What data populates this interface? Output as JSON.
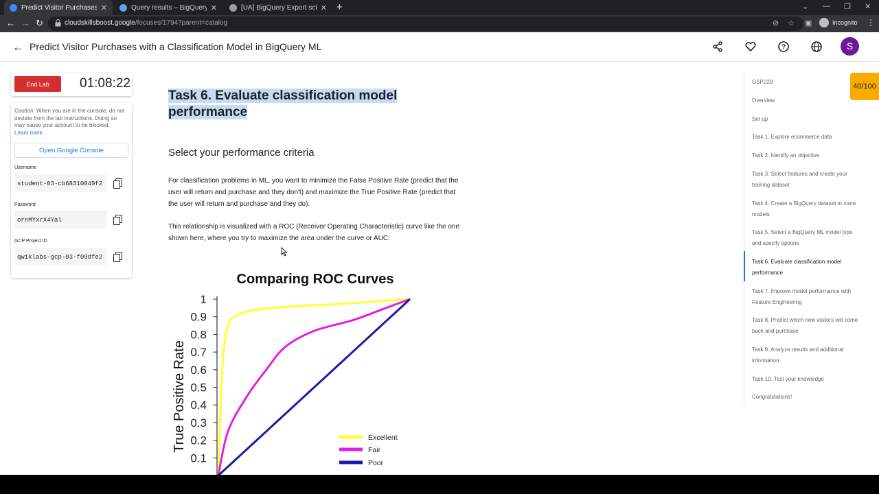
{
  "browser": {
    "tabs": [
      {
        "title": "Predict Visitor Purchases with a C",
        "active": true
      },
      {
        "title": "Query results – BigQuery – qwikl",
        "active": false
      },
      {
        "title": "[UA] BigQuery Export schema - A",
        "active": false
      }
    ],
    "url_host": "cloudskillsboost.google",
    "url_path": "/focuses/1794?parent=catalog",
    "incognito_label": "Incognito"
  },
  "header": {
    "title": "Predict Visitor Purchases with a Classification Model in BigQuery ML",
    "avatar_letter": "S",
    "icons": [
      "share-icon",
      "heart-icon",
      "help-icon",
      "globe-icon"
    ]
  },
  "lab": {
    "end_label": "End Lab",
    "timer": "01:08:22",
    "caution": "Caution: When you are in the console, do not deviate from the lab instructions. Doing so may cause your account to be blocked.",
    "learn_more": "Learn more",
    "console_button": "Open Google Console",
    "username_label": "Username",
    "username": "student-03-cb68310049f2",
    "password_label": "Password",
    "password": "ornMYxrX4Yal",
    "project_label": "GCP Project ID",
    "project_id": "qwiklabs-gcp-03-f09dfe2"
  },
  "content": {
    "heading": "Task 6. Evaluate classification model performance",
    "subheading": "Select your performance criteria",
    "para1": "For classification problems in ML, you want to minimize the False Positive Rate (predict that the user will return and purchase and they don't) and maximize the True Positive Rate (predict that the user will return and purchase and they do).",
    "para2": "This relationship is visualized with a ROC (Receiver Operating Characteristic) curve like the one shown here, where you try to maximize the area under the curve or AUC:"
  },
  "chart_data": {
    "type": "line",
    "title": "Comparing ROC Curves",
    "ylabel": "True Positive Rate",
    "xlabel": "",
    "ylim": [
      0,
      1
    ],
    "xlim": [
      0,
      1
    ],
    "y_ticks": [
      "0.1",
      "0.2",
      "0.3",
      "0.4",
      "0.5",
      "0.6",
      "0.7",
      "0.8",
      "0.9",
      "1"
    ],
    "legend_position": "bottom-right",
    "series": [
      {
        "name": "Excellent",
        "color": "#ffff33",
        "x": [
          0,
          0.02,
          0.05,
          0.1,
          0.2,
          0.4,
          0.6,
          0.8,
          1.0
        ],
        "y": [
          0,
          0.6,
          0.85,
          0.91,
          0.94,
          0.96,
          0.97,
          0.985,
          1.0
        ]
      },
      {
        "name": "Fair",
        "color": "#e020e0",
        "x": [
          0,
          0.05,
          0.15,
          0.25,
          0.35,
          0.5,
          0.7,
          0.85,
          1.0
        ],
        "y": [
          0,
          0.25,
          0.45,
          0.6,
          0.73,
          0.82,
          0.88,
          0.94,
          1.0
        ]
      },
      {
        "name": "Poor",
        "color": "#1a1aaa",
        "x": [
          0,
          1
        ],
        "y": [
          0,
          1
        ]
      }
    ]
  },
  "toc": {
    "items": [
      "GSP229",
      "Overview",
      "Set up",
      "Task 1. Explore ecommerce data",
      "Task 2. Identify an objective",
      "Task 3. Select features and create your training dataset",
      "Task 4. Create a BigQuery dataset to store models",
      "Task 5. Select a BigQuery ML model type and specify options",
      "Task 6. Evaluate classification model performance",
      "Task 7. Improve model performance with Feature Engineering",
      "Task 8. Predict which new visitors will come back and purchase",
      "Task 9. Analyze results and additional information",
      "Task 10. Test your knowledge",
      "Congratulations!"
    ],
    "active_index": 8
  },
  "score": "40/100"
}
